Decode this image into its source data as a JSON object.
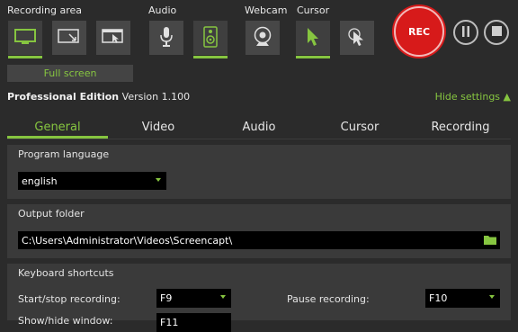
{
  "toolbar": {
    "recording_area_label": "Recording area",
    "audio_label": "Audio",
    "webcam_label": "Webcam",
    "cursor_label": "Cursor",
    "full_screen_label": "Full screen",
    "rec_label": "REC",
    "accent_color": "#86c540",
    "rec_color": "#d71a1a"
  },
  "edition": {
    "name": "Professional Edition",
    "version": "Version 1.100",
    "hide_settings": "Hide settings ▲"
  },
  "tabs": [
    {
      "label": "General",
      "active": true
    },
    {
      "label": "Video",
      "active": false
    },
    {
      "label": "Audio",
      "active": false
    },
    {
      "label": "Cursor",
      "active": false
    },
    {
      "label": "Recording",
      "active": false
    }
  ],
  "program_language": {
    "heading": "Program language",
    "value": "english"
  },
  "output_folder": {
    "heading": "Output folder",
    "value": "C:\\Users\\Administrator\\Videos\\Screencapt\\"
  },
  "keyboard_shortcuts": {
    "heading": "Keyboard shortcuts",
    "start_stop_label": "Start/stop recording:",
    "start_stop_value": "F9",
    "pause_label": "Pause recording:",
    "pause_value": "F10",
    "third_label": "Show/hide window:",
    "third_value": "F11"
  }
}
